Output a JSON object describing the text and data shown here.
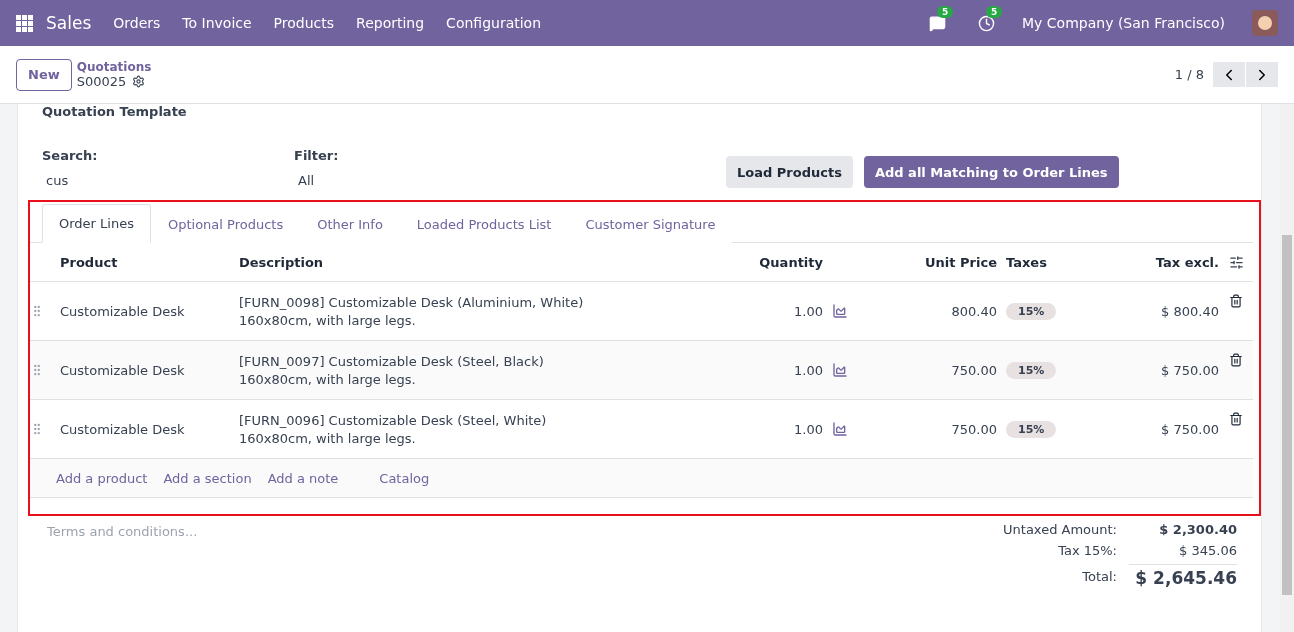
{
  "navbar": {
    "app": "Sales",
    "menu": [
      "Orders",
      "To Invoice",
      "Products",
      "Reporting",
      "Configuration"
    ],
    "messages_badge": "5",
    "activities_badge": "5",
    "company": "My Company (San Francisco)"
  },
  "control_panel": {
    "new_button": "New",
    "breadcrumb": "Quotations",
    "record": "S00025",
    "pager": "1 / 8"
  },
  "loader": {
    "section_title": "Quotation Template",
    "search_label": "Search:",
    "search_value": "cus",
    "filter_label": "Filter:",
    "filter_value": "All",
    "buttons": [
      {
        "label": "Load Products",
        "kind": "secondary"
      },
      {
        "label": "Add all Matching to Order Lines",
        "kind": "primary"
      }
    ]
  },
  "tabs": [
    {
      "label": "Order Lines",
      "selected": true
    },
    {
      "label": "Optional Products",
      "selected": false
    },
    {
      "label": "Other Info",
      "selected": false
    },
    {
      "label": "Loaded Products List",
      "selected": false
    },
    {
      "label": "Customer Signature",
      "selected": false
    }
  ],
  "table": {
    "columns": [
      "Product",
      "Description",
      "Quantity",
      "Unit Price",
      "Taxes",
      "Tax excl."
    ],
    "rows": [
      {
        "product": "Customizable Desk",
        "description": [
          "[FURN_0098] Customizable Desk (Aluminium, White)",
          "160x80cm, with large legs."
        ],
        "quantity": "1.00",
        "unit_price": "800.40",
        "taxes": "15%",
        "subtotal": "$ 800.40"
      },
      {
        "product": "Customizable Desk",
        "description": [
          "[FURN_0097] Customizable Desk (Steel, Black)",
          "160x80cm, with large legs."
        ],
        "quantity": "1.00",
        "unit_price": "750.00",
        "taxes": "15%",
        "subtotal": "$ 750.00"
      },
      {
        "product": "Customizable Desk",
        "description": [
          "[FURN_0096] Customizable Desk (Steel, White)",
          "160x80cm, with large legs."
        ],
        "quantity": "1.00",
        "unit_price": "750.00",
        "taxes": "15%",
        "subtotal": "$ 750.00"
      }
    ],
    "add_links": [
      "Add a product",
      "Add a section",
      "Add a note",
      "Catalog"
    ]
  },
  "terms": {
    "placeholder": "Terms and conditions..."
  },
  "totals": [
    {
      "label": "Untaxed Amount:",
      "value": "$ 2,300.40",
      "kind": "untaxed"
    },
    {
      "label": "Tax 15%:",
      "value": "$ 345.06",
      "kind": "tax"
    },
    {
      "label": "Total:",
      "value": "$ 2,645.46",
      "kind": "total"
    }
  ]
}
